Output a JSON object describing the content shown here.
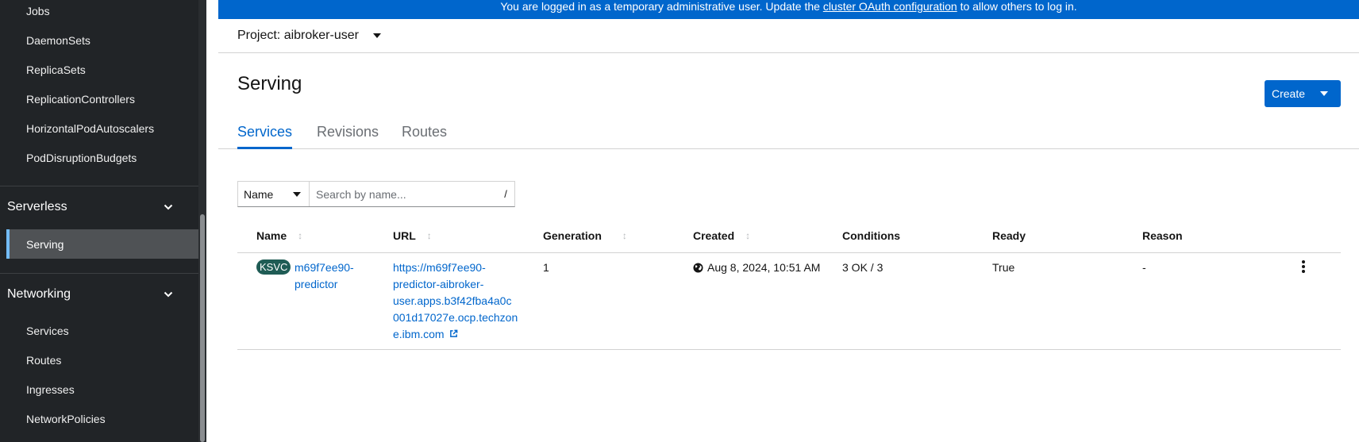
{
  "sidebar": {
    "items_top": [
      "Jobs",
      "DaemonSets",
      "ReplicaSets",
      "ReplicationControllers",
      "HorizontalPodAutoscalers",
      "PodDisruptionBudgets"
    ],
    "section_serverless": "Serverless",
    "serving": "Serving",
    "section_networking": "Networking",
    "networking_items": [
      "Services",
      "Routes",
      "Ingresses",
      "NetworkPolicies"
    ]
  },
  "banner": {
    "prefix": "You are logged in as a temporary administrative user. Update the ",
    "link": "cluster OAuth configuration",
    "suffix": " to allow others to log in."
  },
  "project": {
    "label": "Project: aibroker-user"
  },
  "page": {
    "title": "Serving",
    "create_label": "Create"
  },
  "tabs": [
    "Services",
    "Revisions",
    "Routes"
  ],
  "filter": {
    "dropdown_label": "Name",
    "placeholder": "Search by name...",
    "shortcut": "/"
  },
  "table": {
    "headers": [
      "Name",
      "URL",
      "Generation",
      "Created",
      "Conditions",
      "Ready",
      "Reason"
    ],
    "rows": [
      {
        "badge": "KSVC",
        "name_line1": "m69f7ee90-",
        "name_line2": "predictor",
        "url_lines": [
          "https://m69f7ee90-",
          "predictor-aibroker-",
          "user.apps.b3f42fba4a0c",
          "001d17027e.ocp.techzon",
          "e.ibm.com"
        ],
        "generation": "1",
        "created": "Aug 8, 2024, 10:51 AM",
        "conditions": "3 OK / 3",
        "ready": "True",
        "reason": "-"
      }
    ]
  },
  "colors": {
    "accent": "#0066cc",
    "sidebar_bg": "#212427",
    "badge_bg": "#1f5c55"
  },
  "icons": [
    "chevron-down-icon",
    "caret-down-icon",
    "sort-icon",
    "globe-icon",
    "external-link-icon",
    "kebab-icon"
  ]
}
